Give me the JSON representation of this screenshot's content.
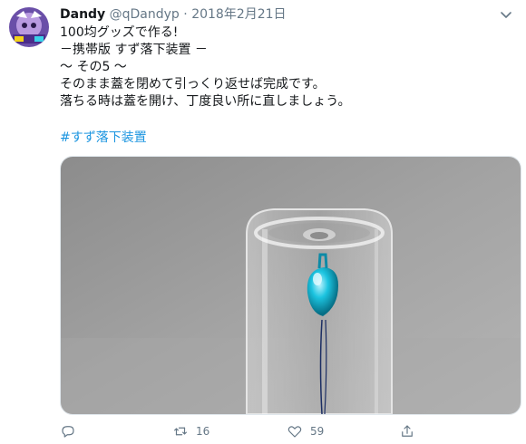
{
  "tweet": {
    "display_name": "Dandy",
    "handle": "@qDandyp",
    "separator": "·",
    "date": "2018年2月21日",
    "avatar_icon": "avatar-image",
    "lines": [
      "100均グッズで作る!",
      "－携帯版 すず落下装置 －",
      "〜 その5 〜",
      "そのまま蓋を閉めて引っくり返せば完成です。",
      "落ちる時は蓋を開け、丁度良い所に直しましょう。"
    ],
    "hashtag": "#すず落下装置",
    "media_icon": "glass-bottle-with-bell-photo"
  },
  "actions": {
    "reply_icon": "reply-icon",
    "retweet_icon": "retweet-icon",
    "retweet_count": "16",
    "like_icon": "heart-icon",
    "like_count": "59",
    "share_icon": "share-icon"
  },
  "colors": {
    "accent": "#1b95e0",
    "muted": "#657786",
    "text": "#14171a"
  }
}
